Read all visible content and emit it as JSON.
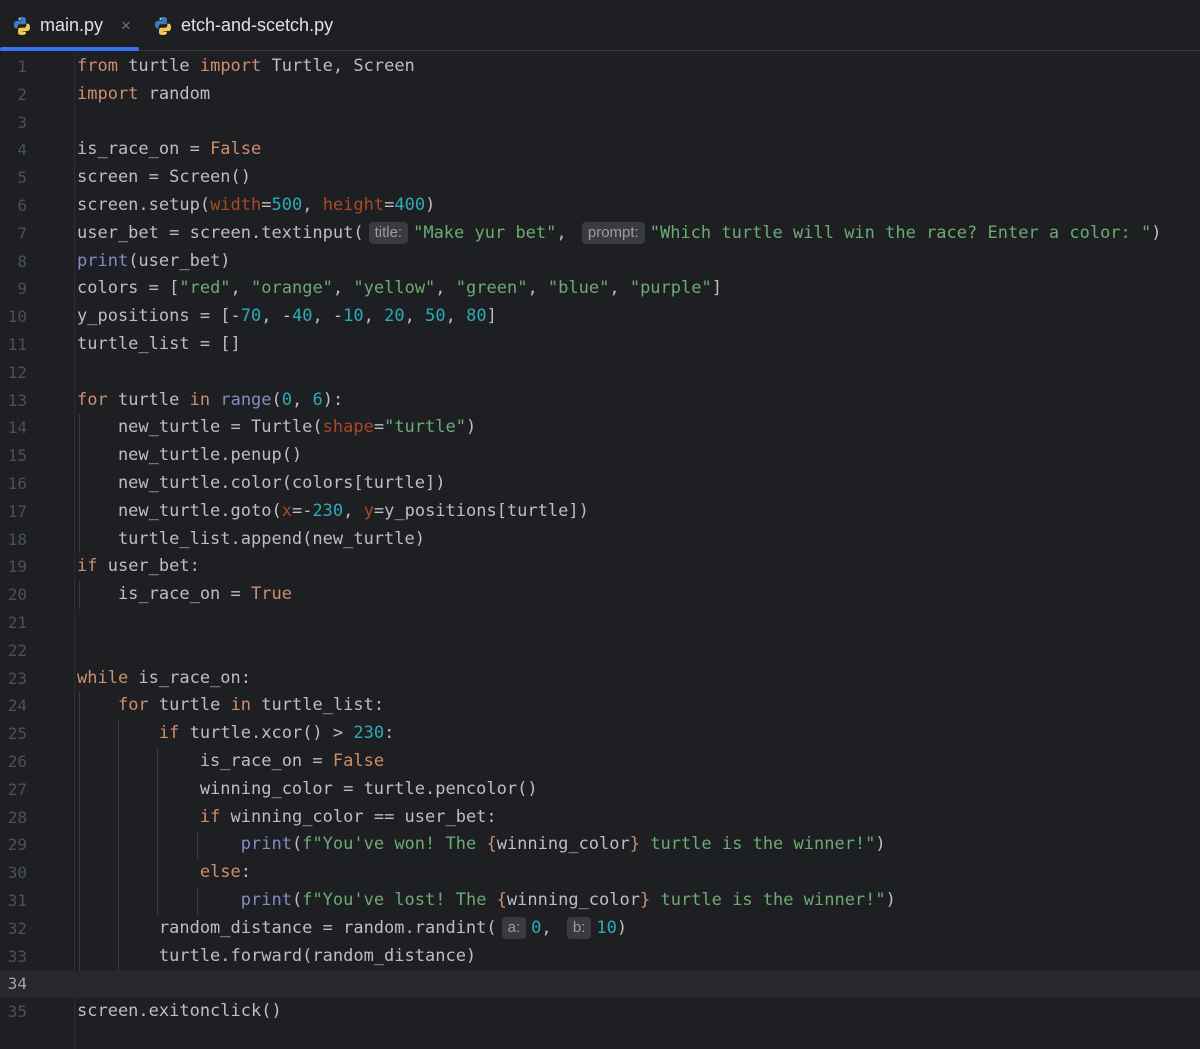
{
  "tabs": [
    {
      "label": "main.py",
      "active": true,
      "close_glyph": "×",
      "icon": "python-icon"
    },
    {
      "label": "etch-and-scetch.py",
      "active": false,
      "icon": "python-icon"
    }
  ],
  "current_line": 34,
  "code_lines": [
    [
      [
        "kw",
        "from"
      ],
      [
        "p",
        " turtle "
      ],
      [
        "kw",
        "import"
      ],
      [
        "p",
        " Turtle, Screen"
      ]
    ],
    [
      [
        "kw",
        "import"
      ],
      [
        "p",
        " random"
      ]
    ],
    [],
    [
      [
        "p",
        "is_race_on = "
      ],
      [
        "kw",
        "False"
      ]
    ],
    [
      [
        "p",
        "screen = Screen()"
      ]
    ],
    [
      [
        "p",
        "screen.setup("
      ],
      [
        "param",
        "width"
      ],
      [
        "p",
        "="
      ],
      [
        "num",
        "500"
      ],
      [
        "p",
        ", "
      ],
      [
        "param",
        "height"
      ],
      [
        "p",
        "="
      ],
      [
        "num",
        "400"
      ],
      [
        "p",
        ")"
      ]
    ],
    [
      [
        "p",
        "user_bet = screen.textinput("
      ],
      [
        "hint",
        "title:"
      ],
      [
        "str",
        "\"Make yur bet\""
      ],
      [
        "p",
        ", "
      ],
      [
        "hint",
        "prompt:"
      ],
      [
        "str",
        "\"Which turtle will win the race? Enter a color: \""
      ],
      [
        "p",
        ")"
      ]
    ],
    [
      [
        "bi",
        "print"
      ],
      [
        "p",
        "(user_bet)"
      ]
    ],
    [
      [
        "p",
        "colors = ["
      ],
      [
        "str",
        "\"red\""
      ],
      [
        "p",
        ", "
      ],
      [
        "str",
        "\"orange\""
      ],
      [
        "p",
        ", "
      ],
      [
        "str",
        "\"yellow\""
      ],
      [
        "p",
        ", "
      ],
      [
        "str",
        "\"green\""
      ],
      [
        "p",
        ", "
      ],
      [
        "str",
        "\"blue\""
      ],
      [
        "p",
        ", "
      ],
      [
        "str",
        "\"purple\""
      ],
      [
        "p",
        "]"
      ]
    ],
    [
      [
        "p",
        "y_positions = [-"
      ],
      [
        "num",
        "70"
      ],
      [
        "p",
        ", -"
      ],
      [
        "num",
        "40"
      ],
      [
        "p",
        ", -"
      ],
      [
        "num",
        "10"
      ],
      [
        "p",
        ", "
      ],
      [
        "num",
        "20"
      ],
      [
        "p",
        ", "
      ],
      [
        "num",
        "50"
      ],
      [
        "p",
        ", "
      ],
      [
        "num",
        "80"
      ],
      [
        "p",
        "]"
      ]
    ],
    [
      [
        "p",
        "turtle_list = []"
      ]
    ],
    [],
    [
      [
        "kw",
        "for"
      ],
      [
        "p",
        " turtle "
      ],
      [
        "kw",
        "in"
      ],
      [
        "p",
        " "
      ],
      [
        "bi",
        "range"
      ],
      [
        "p",
        "("
      ],
      [
        "num",
        "0"
      ],
      [
        "p",
        ", "
      ],
      [
        "num",
        "6"
      ],
      [
        "p",
        "):"
      ]
    ],
    [
      [
        "p",
        "    new_turtle = Turtle("
      ],
      [
        "param",
        "shape"
      ],
      [
        "p",
        "="
      ],
      [
        "str",
        "\"turtle\""
      ],
      [
        "p",
        ")"
      ]
    ],
    [
      [
        "p",
        "    new_turtle.penup()"
      ]
    ],
    [
      [
        "p",
        "    new_turtle.color(colors[turtle])"
      ]
    ],
    [
      [
        "p",
        "    new_turtle.goto("
      ],
      [
        "param",
        "x"
      ],
      [
        "p",
        "=-"
      ],
      [
        "num",
        "230"
      ],
      [
        "p",
        ", "
      ],
      [
        "param",
        "y"
      ],
      [
        "p",
        "=y_positions[turtle])"
      ]
    ],
    [
      [
        "p",
        "    turtle_list.append(new_turtle)"
      ]
    ],
    [
      [
        "kw",
        "if"
      ],
      [
        "p",
        " user_bet:"
      ]
    ],
    [
      [
        "p",
        "    is_race_on = "
      ],
      [
        "kw",
        "True"
      ]
    ],
    [],
    [],
    [
      [
        "kw",
        "while"
      ],
      [
        "p",
        " is_race_on:"
      ]
    ],
    [
      [
        "p",
        "    "
      ],
      [
        "kw",
        "for"
      ],
      [
        "p",
        " turtle "
      ],
      [
        "kw",
        "in"
      ],
      [
        "p",
        " turtle_list:"
      ]
    ],
    [
      [
        "p",
        "        "
      ],
      [
        "kw",
        "if"
      ],
      [
        "p",
        " turtle.xcor() > "
      ],
      [
        "num",
        "230"
      ],
      [
        "p",
        ":"
      ]
    ],
    [
      [
        "p",
        "            is_race_on = "
      ],
      [
        "kw",
        "False"
      ]
    ],
    [
      [
        "p",
        "            winning_color = turtle.pencolor()"
      ]
    ],
    [
      [
        "p",
        "            "
      ],
      [
        "kw",
        "if"
      ],
      [
        "p",
        " winning_color == user_bet:"
      ]
    ],
    [
      [
        "p",
        "                "
      ],
      [
        "bi",
        "print"
      ],
      [
        "p",
        "("
      ],
      [
        "str",
        "f\"You've won! The "
      ],
      [
        "kw",
        "{"
      ],
      [
        "p",
        "winning_color"
      ],
      [
        "kw",
        "}"
      ],
      [
        "str",
        " turtle is the winner!\""
      ],
      [
        "p",
        ")"
      ]
    ],
    [
      [
        "p",
        "            "
      ],
      [
        "kw",
        "else"
      ],
      [
        "p",
        ":"
      ]
    ],
    [
      [
        "p",
        "                "
      ],
      [
        "bi",
        "print"
      ],
      [
        "p",
        "("
      ],
      [
        "str",
        "f\"You've lost! The "
      ],
      [
        "kw",
        "{"
      ],
      [
        "p",
        "winning_color"
      ],
      [
        "kw",
        "}"
      ],
      [
        "str",
        " turtle is the winner!\""
      ],
      [
        "p",
        ")"
      ]
    ],
    [
      [
        "p",
        "        random_distance = random.randint("
      ],
      [
        "hint",
        "a:"
      ],
      [
        "num",
        "0"
      ],
      [
        "p",
        ", "
      ],
      [
        "hint",
        "b:"
      ],
      [
        "num",
        "10"
      ],
      [
        "p",
        ")"
      ]
    ],
    [
      [
        "p",
        "        turtle.forward(random_distance)"
      ]
    ],
    [],
    [
      [
        "p",
        "screen.exitonclick()"
      ]
    ]
  ]
}
